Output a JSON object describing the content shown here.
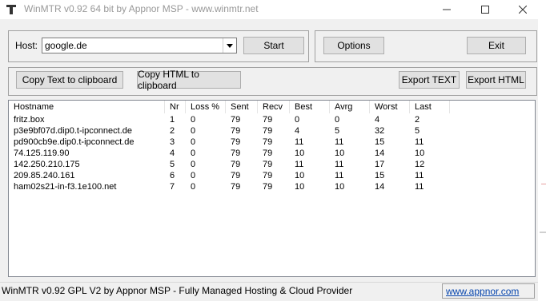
{
  "window": {
    "title": "WinMTR v0.92 64 bit by Appnor MSP - www.winmtr.net"
  },
  "host": {
    "label": "Host:",
    "value": "google.de"
  },
  "buttons": {
    "start": "Start",
    "options": "Options",
    "exit": "Exit",
    "copy_text": "Copy Text to clipboard",
    "copy_html": "Copy HTML to clipboard",
    "export_text": "Export TEXT",
    "export_html": "Export HTML"
  },
  "table": {
    "columns": [
      "Hostname",
      "Nr",
      "Loss %",
      "Sent",
      "Recv",
      "Best",
      "Avrg",
      "Worst",
      "Last"
    ],
    "rows": [
      [
        "fritz.box",
        "1",
        "0",
        "79",
        "79",
        "0",
        "0",
        "4",
        "2"
      ],
      [
        "p3e9bf07d.dip0.t-ipconnect.de",
        "2",
        "0",
        "79",
        "79",
        "4",
        "5",
        "32",
        "5"
      ],
      [
        "pd900cb9e.dip0.t-ipconnect.de",
        "3",
        "0",
        "79",
        "79",
        "11",
        "11",
        "15",
        "11"
      ],
      [
        "74.125.119.90",
        "4",
        "0",
        "79",
        "79",
        "10",
        "10",
        "14",
        "10"
      ],
      [
        "142.250.210.175",
        "5",
        "0",
        "79",
        "79",
        "11",
        "11",
        "17",
        "12"
      ],
      [
        "209.85.240.161",
        "6",
        "0",
        "79",
        "79",
        "10",
        "11",
        "15",
        "11"
      ],
      [
        "ham02s21-in-f3.1e100.net",
        "7",
        "0",
        "79",
        "79",
        "10",
        "10",
        "14",
        "11"
      ]
    ]
  },
  "status": {
    "text": "WinMTR v0.92 GPL V2 by Appnor MSP - Fully Managed Hosting & Cloud Provider",
    "link": "www.appnor.com"
  }
}
